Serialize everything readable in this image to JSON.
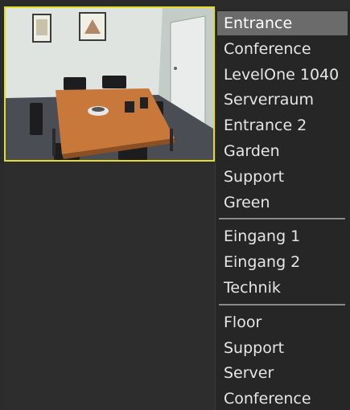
{
  "camera_view": {
    "selected_camera": "Conference",
    "highlight_color": "#e4dc2a"
  },
  "camera_menu": {
    "groups": [
      [
        "Entrance",
        "Conference",
        "LevelOne 1040",
        "Serverraum",
        "Entrance 2",
        "Garden",
        "Support",
        "Green"
      ],
      [
        "Eingang 1",
        "Eingang 2",
        "Technik"
      ],
      [
        "Floor",
        "Support",
        "Server",
        "Conference"
      ]
    ],
    "selected_index": 0
  }
}
